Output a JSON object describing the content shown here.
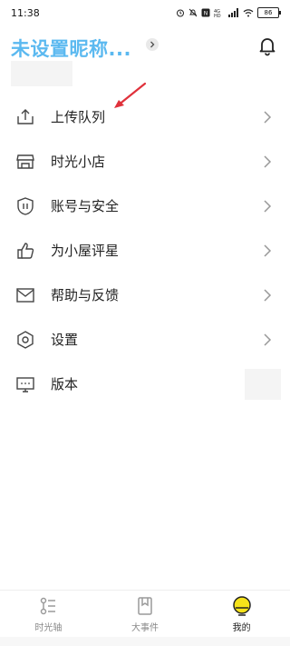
{
  "status_bar": {
    "time": "11:38",
    "battery": "86",
    "icons": [
      "alarm-icon",
      "mute-icon",
      "nfc-icon",
      "hd-icon",
      "signal-icon",
      "wifi-icon",
      "battery-icon"
    ]
  },
  "header": {
    "nickname": "未设置昵称...",
    "nickname_color": "#5BB9F0",
    "bell_icon": "bell-icon"
  },
  "menu": {
    "items": [
      {
        "label": "上传队列",
        "icon": "upload-icon"
      },
      {
        "label": "时光小店",
        "icon": "store-icon"
      },
      {
        "label": "账号与安全",
        "icon": "shield-icon"
      },
      {
        "label": "为小屋评星",
        "icon": "thumbs-up-icon"
      },
      {
        "label": "帮助与反馈",
        "icon": "mail-icon"
      },
      {
        "label": "设置",
        "icon": "settings-icon"
      },
      {
        "label": "版本",
        "icon": "monitor-icon"
      }
    ]
  },
  "tabbar": {
    "tabs": [
      {
        "label": "时光轴",
        "icon": "timeline-icon",
        "active": false
      },
      {
        "label": "大事件",
        "icon": "bookmark-icon",
        "active": false
      },
      {
        "label": "我的",
        "icon": "profile-face-icon",
        "active": true
      }
    ],
    "active_color": "#F5E21A"
  }
}
